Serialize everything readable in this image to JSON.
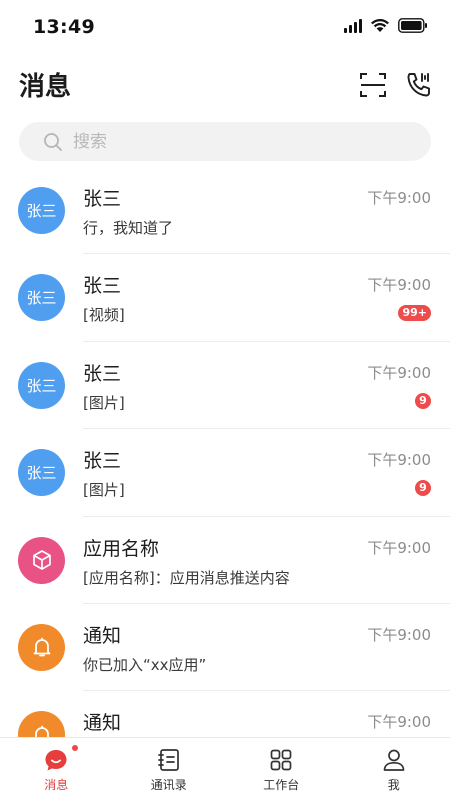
{
  "status_bar": {
    "time": "13:49"
  },
  "header": {
    "title": "消息"
  },
  "search": {
    "placeholder": "搜索"
  },
  "colors": {
    "avatar_blue": "#4f9ef0",
    "avatar_pink": "#e85285",
    "avatar_orange": "#f08a2a",
    "badge_red": "#ee4b4b",
    "accent": "#e63d3d"
  },
  "conversations": [
    {
      "avatar_text": "张三",
      "name": "张三",
      "preview": "行，我知道了",
      "time": "下午9:00",
      "badge": ""
    },
    {
      "avatar_text": "张三",
      "name": "张三",
      "preview": "[视频]",
      "time": "下午9:00",
      "badge": "99+"
    },
    {
      "avatar_text": "张三",
      "name": "张三",
      "preview": "[图片]",
      "time": "下午9:00",
      "badge": "9"
    },
    {
      "avatar_text": "张三",
      "name": "张三",
      "preview": "[图片]",
      "time": "下午9:00",
      "badge": "9"
    },
    {
      "avatar_icon": "cube-icon",
      "name": "应用名称",
      "preview": "[应用名称]：应用消息推送内容",
      "time": "下午9:00",
      "badge": ""
    },
    {
      "avatar_icon": "bell-icon",
      "name": "通知",
      "preview": "你已加入“xx应用”",
      "time": "下午9:00",
      "badge": ""
    },
    {
      "avatar_icon": "bell-icon",
      "name": "通知",
      "preview": "",
      "time": "下午9:00",
      "badge": ""
    }
  ],
  "tabs": [
    {
      "label": "消息",
      "icon": "chat-icon",
      "active": true
    },
    {
      "label": "通讯录",
      "icon": "contacts-icon",
      "active": false
    },
    {
      "label": "工作台",
      "icon": "grid-icon",
      "active": false
    },
    {
      "label": "我",
      "icon": "person-icon",
      "active": false
    }
  ]
}
